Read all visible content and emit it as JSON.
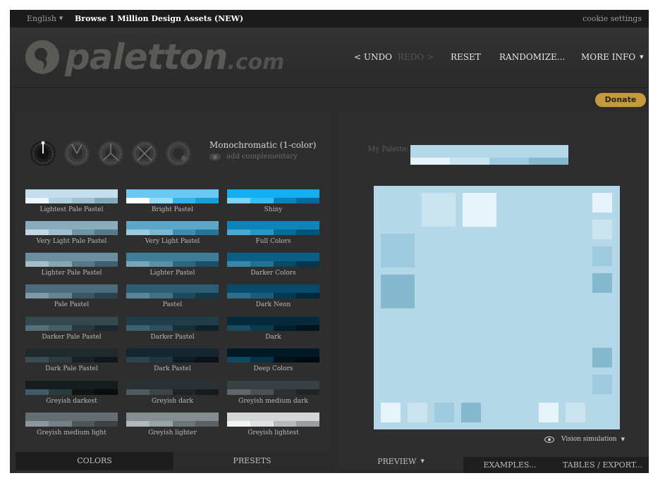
{
  "topbar": {
    "language": "English",
    "browse": "Browse 1 Million Design Assets (NEW)",
    "cookie": "cookie settings"
  },
  "logo": {
    "name": "paletton",
    "domain": ".com"
  },
  "nav": {
    "undo": "< UNDO",
    "redo": "REDO >",
    "reset": "RESET",
    "randomize": "RANDOMIZE...",
    "more_info": "MORE INFO"
  },
  "donate": "Donate",
  "mode": {
    "title": "Monochromatic (1-color)",
    "complementary": "add complementary"
  },
  "wheels": [
    "mono-wheel-icon",
    "adjacent-wheel-icon",
    "triad-wheel-icon",
    "tetrad-wheel-icon",
    "free-style-wheel-icon"
  ],
  "presets": [
    {
      "label": "Lightest Pale Pastel",
      "colors": [
        "#c4dfeb",
        "#eef6fa",
        "#b3d1de",
        "#9cc0d0",
        "#82abbd"
      ]
    },
    {
      "label": "Bright Pastel",
      "colors": [
        "#6ac8f3",
        "#ffffff",
        "#99dcf7",
        "#34b4ea",
        "#1b9ed8"
      ]
    },
    {
      "label": "Shiny",
      "colors": [
        "#12aef0",
        "#7ed4f7",
        "#38bdf3",
        "#0b84bd",
        "#066b9c"
      ]
    },
    {
      "label": "Very Light Pale Pastel",
      "colors": [
        "#89adbd",
        "#c2d8e2",
        "#a1bfcc",
        "#6f94a4",
        "#587b8b"
      ]
    },
    {
      "label": "Very Light Pastel",
      "colors": [
        "#5ba7c9",
        "#9ccbe0",
        "#7bb8d4",
        "#3d8db1",
        "#247597"
      ]
    },
    {
      "label": "Full Colors",
      "colors": [
        "#0a86bb",
        "#4aa8d2",
        "#2896c7",
        "#056c98",
        "#025479"
      ]
    },
    {
      "label": "Lighter Pale Pastel",
      "colors": [
        "#6c8fa0",
        "#a3bdc9",
        "#86a6b4",
        "#557786",
        "#405f6e"
      ]
    },
    {
      "label": "Lighter Pastel",
      "colors": [
        "#3f7d98",
        "#76a4b8",
        "#5a91a9",
        "#2c667f",
        "#1b5068"
      ]
    },
    {
      "label": "Darker Colors",
      "colors": [
        "#0b5f84",
        "#3a86a8",
        "#1f7196",
        "#064a68",
        "#033750"
      ]
    },
    {
      "label": "Pale Pastel",
      "colors": [
        "#4c6c7b",
        "#7f9aa6",
        "#658390",
        "#3a5663",
        "#2a434f"
      ]
    },
    {
      "label": "Pastel",
      "colors": [
        "#2c5d73",
        "#5a8497",
        "#427185",
        "#1f4a5d",
        "#143848"
      ]
    },
    {
      "label": "Dark Neon",
      "colors": [
        "#074a69",
        "#2f6f8c",
        "#185d7b",
        "#043851",
        "#02283b"
      ]
    },
    {
      "label": "Darker Pale Pastel",
      "colors": [
        "#34484f",
        "#567079",
        "#455d66",
        "#27393f",
        "#1b2a2f"
      ]
    },
    {
      "label": "Darker Pastel",
      "colors": [
        "#203e4a",
        "#3d6170",
        "#2e4f5d",
        "#172f39",
        "#0f222a"
      ]
    },
    {
      "label": "Dark",
      "colors": [
        "#042a3b",
        "#1b4a60",
        "#0d394c",
        "#021e2b",
        "#01141d"
      ]
    },
    {
      "label": "Dark Pale Pastel",
      "colors": [
        "#1f2a2e",
        "#3a4b51",
        "#2c393e",
        "#172024",
        "#10171a"
      ]
    },
    {
      "label": "Dark Pastel",
      "colors": [
        "#142630",
        "#2b4450",
        "#1f3540",
        "#0d1b22",
        "#081218"
      ]
    },
    {
      "label": "Deep Colors",
      "colors": [
        "#021a26",
        "#0f4862",
        "#073245",
        "#01121a",
        "#000b10"
      ]
    },
    {
      "label": "Greyish darkest",
      "colors": [
        "#161b1d",
        "#3f5c6a",
        "#2a3a41",
        "#101415",
        "#0a0d0e"
      ]
    },
    {
      "label": "Greyish dark",
      "colors": [
        "#2a3235",
        "#4d5a60",
        "#3a4449",
        "#1f2527",
        "#161a1c"
      ]
    },
    {
      "label": "Greyish medium dark",
      "colors": [
        "#3a4144",
        "#5e686c",
        "#4a5256",
        "#2b3133",
        "#202426"
      ]
    },
    {
      "label": "Greyish medium light",
      "colors": [
        "#646d71",
        "#8d979b",
        "#778185",
        "#4e5659",
        "#3d4345"
      ]
    },
    {
      "label": "Greyish lighter",
      "colors": [
        "#868e91",
        "#b1b8bb",
        "#9ca3a6",
        "#6e7578",
        "#5a6063"
      ]
    },
    {
      "label": "Greyish lightest",
      "colors": [
        "#d3d7d8",
        "#f2f4f4",
        "#dfe2e3",
        "#b5babc",
        "#9aa0a2"
      ]
    }
  ],
  "palette": {
    "label": "My Palette:",
    "colors": [
      "#b4d8e8",
      "#e6f4fa",
      "#c9e4ef",
      "#9fc9dc",
      "#86b8ce"
    ]
  },
  "preview": {
    "background": "#b4d8e8",
    "swatches": [
      "#e6f4fa",
      "#c9e4ef",
      "#9fc9dc",
      "#86b8ce"
    ]
  },
  "vision": "Vision simulation",
  "tabs": {
    "colors": "COLORS",
    "presets": "PRESETS",
    "preview": "PREVIEW",
    "examples": "EXAMPLES...",
    "tables": "TABLES / EXPORT..."
  }
}
